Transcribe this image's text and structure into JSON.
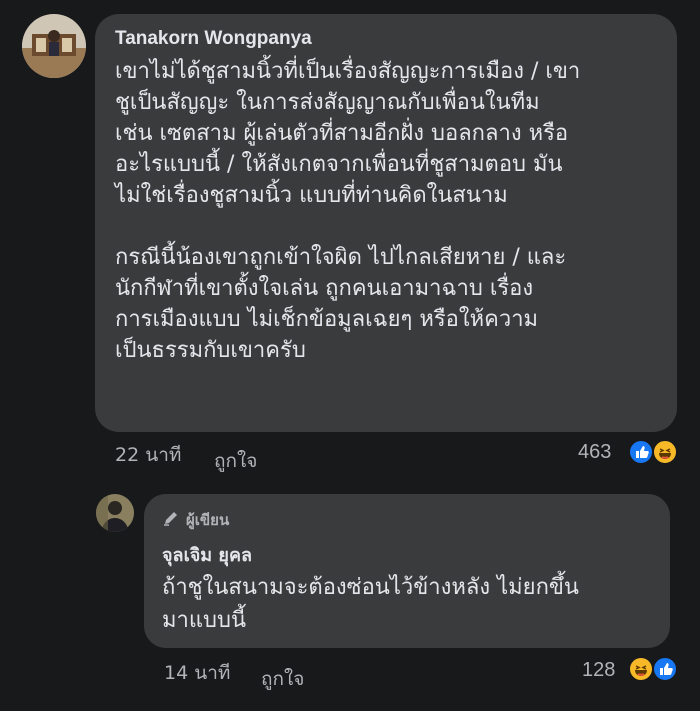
{
  "comment": {
    "author": "Tanakorn Wongpanya",
    "paragraph1": "เขาไม่ได้ชูสามนิ้วที่เป็นเรื่องสัญญะการเมือง / เขา\nชูเป็นสัญญะ ในการส่งสัญญาณกับเพื่อนในทีม\nเช่น เซตสาม ผู้เล่นตัวที่สามอีกฝั่ง บอลกลาง หรือ\nอะไรแบบนี้ / ให้สังเกตจากเพื่อนที่ชูสามตอบ มัน\nไม่ใช่เรื่องชูสามนิ้ว แบบที่ท่านคิดในสนาม",
    "paragraph2": "กรณีนี้น้องเขาถูกเข้าใจผิด ไปไกลเสียหาย / และ\nนักกีฬาที่เขาตั้งใจเล่น ถูกคนเอามาฉาบ เรื่อง\nการเมืองแบบ ไม่เช็กข้อมูลเฉยๆ หรือให้ความ\nเป็นธรรมกับเขาครับ",
    "time": "22 นาที",
    "like_label": "ถูกใจ",
    "reaction_count": "463"
  },
  "reply": {
    "badge": "ผู้เขียน",
    "author": "จุลเจิม ยุคล",
    "text": "ถ้าชูในสนามจะต้องซ่อนไว้ข้างหลัง ไม่ยกขึ้น\nมาแบบนี้",
    "time": "14 นาที",
    "like_label": "ถูกใจ",
    "reaction_count": "128"
  },
  "colors": {
    "background": "#18191a",
    "bubble": "#3a3b3c",
    "like_blue": "#1877f2",
    "haha_yellow": "#f7b928"
  }
}
